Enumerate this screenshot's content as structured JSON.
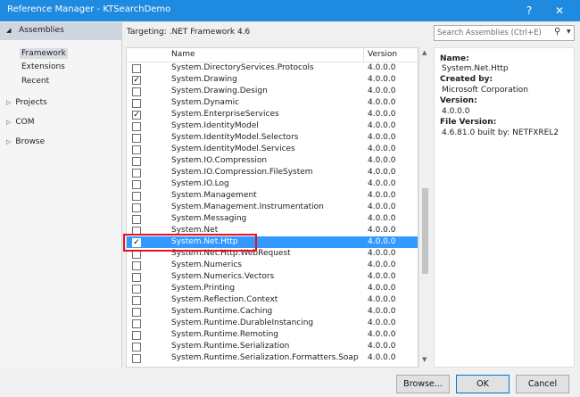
{
  "window": {
    "title": "Reference Manager - KTSearchDemo",
    "help": "?",
    "close": "✕"
  },
  "nav": {
    "header": "Assemblies",
    "subitems": [
      "Framework",
      "Extensions",
      "Recent"
    ],
    "groups": [
      "Projects",
      "COM",
      "Browse"
    ]
  },
  "targeting": "Targeting: .NET Framework 4.6",
  "search": {
    "placeholder": "Search Assemblies (Ctrl+E)"
  },
  "list": {
    "headers": {
      "name": "Name",
      "version": "Version"
    },
    "rows": [
      {
        "name": "System.DirectoryServices.Protocols",
        "version": "4.0.0.0",
        "checked": false
      },
      {
        "name": "System.Drawing",
        "version": "4.0.0.0",
        "checked": true
      },
      {
        "name": "System.Drawing.Design",
        "version": "4.0.0.0",
        "checked": false
      },
      {
        "name": "System.Dynamic",
        "version": "4.0.0.0",
        "checked": false
      },
      {
        "name": "System.EnterpriseServices",
        "version": "4.0.0.0",
        "checked": true
      },
      {
        "name": "System.IdentityModel",
        "version": "4.0.0.0",
        "checked": false
      },
      {
        "name": "System.IdentityModel.Selectors",
        "version": "4.0.0.0",
        "checked": false
      },
      {
        "name": "System.IdentityModel.Services",
        "version": "4.0.0.0",
        "checked": false
      },
      {
        "name": "System.IO.Compression",
        "version": "4.0.0.0",
        "checked": false
      },
      {
        "name": "System.IO.Compression.FileSystem",
        "version": "4.0.0.0",
        "checked": false
      },
      {
        "name": "System.IO.Log",
        "version": "4.0.0.0",
        "checked": false
      },
      {
        "name": "System.Management",
        "version": "4.0.0.0",
        "checked": false
      },
      {
        "name": "System.Management.Instrumentation",
        "version": "4.0.0.0",
        "checked": false
      },
      {
        "name": "System.Messaging",
        "version": "4.0.0.0",
        "checked": false
      },
      {
        "name": "System.Net",
        "version": "4.0.0.0",
        "checked": false
      },
      {
        "name": "System.Net.Http",
        "version": "4.0.0.0",
        "checked": true,
        "selected": true
      },
      {
        "name": "System.Net.Http.WebRequest",
        "version": "4.0.0.0",
        "checked": false
      },
      {
        "name": "System.Numerics",
        "version": "4.0.0.0",
        "checked": false
      },
      {
        "name": "System.Numerics.Vectors",
        "version": "4.0.0.0",
        "checked": false
      },
      {
        "name": "System.Printing",
        "version": "4.0.0.0",
        "checked": false
      },
      {
        "name": "System.Reflection.Context",
        "version": "4.0.0.0",
        "checked": false
      },
      {
        "name": "System.Runtime.Caching",
        "version": "4.0.0.0",
        "checked": false
      },
      {
        "name": "System.Runtime.DurableInstancing",
        "version": "4.0.0.0",
        "checked": false
      },
      {
        "name": "System.Runtime.Remoting",
        "version": "4.0.0.0",
        "checked": false
      },
      {
        "name": "System.Runtime.Serialization",
        "version": "4.0.0.0",
        "checked": false
      },
      {
        "name": "System.Runtime.Serialization.Formatters.Soap",
        "version": "4.0.0.0",
        "checked": false
      }
    ]
  },
  "details": {
    "name_label": "Name:",
    "name_value": "System.Net.Http",
    "createdby_label": "Created by:",
    "createdby_value": "Microsoft Corporation",
    "version_label": "Version:",
    "version_value": "4.0.0.0",
    "fileversion_label": "File Version:",
    "fileversion_value": "4.6.81.0 built by: NETFXREL2"
  },
  "buttons": {
    "browse": "Browse...",
    "ok": "OK",
    "cancel": "Cancel"
  }
}
